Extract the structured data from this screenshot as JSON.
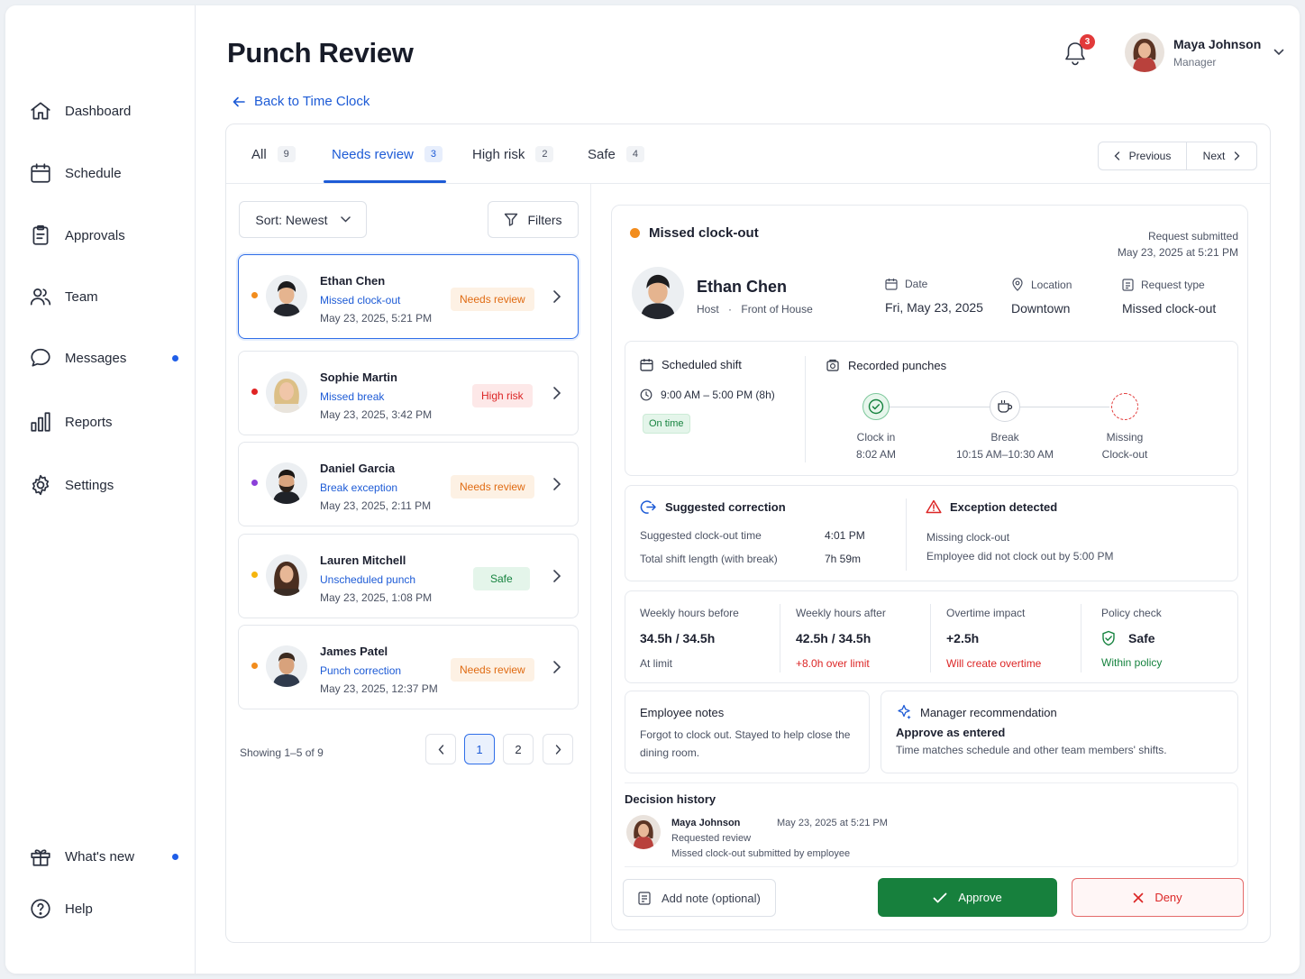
{
  "sidebar": {
    "items": [
      {
        "label": "Dashboard",
        "icon": "home-icon"
      },
      {
        "label": "Schedule",
        "icon": "calendar-icon"
      },
      {
        "label": "Approvals",
        "icon": "clipboard-icon"
      },
      {
        "label": "Team",
        "icon": "users-icon"
      },
      {
        "label": "Messages",
        "icon": "chat-icon",
        "has_dot": true
      },
      {
        "label": "Reports",
        "icon": "bar-chart-icon"
      },
      {
        "label": "Settings",
        "icon": "gear-icon"
      }
    ],
    "bottom": [
      {
        "label": "What's new",
        "icon": "gift-icon",
        "has_dot": true
      },
      {
        "label": "Help",
        "icon": "help-icon"
      }
    ]
  },
  "header": {
    "title": "Punch Review",
    "back_label": "Back to Time Clock",
    "notifications_count": "3",
    "user": {
      "name": "Maya Johnson",
      "role": "Manager"
    }
  },
  "tabs": [
    {
      "label": "All",
      "count": "9"
    },
    {
      "label": "Needs review",
      "count": "3",
      "active": true
    },
    {
      "label": "High risk",
      "count": "2"
    },
    {
      "label": "Safe",
      "count": "4"
    }
  ],
  "pager": {
    "previous": "Previous",
    "next": "Next"
  },
  "list": {
    "sort_label": "Sort: Newest",
    "filters_label": "Filters",
    "rows": [
      {
        "name": "Ethan Chen",
        "event": "Missed clock-out",
        "datetime": "May 23, 2025, 5:21 PM",
        "badge": "Needs review",
        "dot_color": "#f28c1c",
        "selected": true
      },
      {
        "name": "Sophie Martin",
        "event": "Missed break",
        "datetime": "May 23, 2025, 3:42 PM",
        "badge": "High risk",
        "dot_color": "#e02424"
      },
      {
        "name": "Daniel Garcia",
        "event": "Break exception",
        "datetime": "May 23, 2025, 2:11 PM",
        "badge": "Needs review",
        "dot_color": "#8b3fd9"
      },
      {
        "name": "Lauren Mitchell",
        "event": "Unscheduled punch",
        "datetime": "May 23, 2025, 1:08 PM",
        "badge": "Safe",
        "dot_color": "#f5b50e"
      },
      {
        "name": "James Patel",
        "event": "Punch correction",
        "datetime": "May 23, 2025, 12:37 PM",
        "badge": "Needs review",
        "dot_color": "#f28c1c"
      }
    ],
    "showing": "Showing 1–5 of 9",
    "pages": [
      "1",
      "2"
    ],
    "current_page": "1"
  },
  "detail": {
    "status": "Missed clock-out",
    "status_color": "#f28c1c",
    "submitted_label": "Request submitted",
    "submitted_at": "May 23, 2025 at 5:21 PM",
    "employee": {
      "name": "Ethan Chen",
      "role": "Host",
      "department": "Front of House"
    },
    "meta": {
      "date_label": "Date",
      "date_value": "Fri, May 23, 2025",
      "location_label": "Location",
      "location_value": "Downtown",
      "type_label": "Request type",
      "type_value": "Missed clock-out"
    },
    "scheduled": {
      "title": "Scheduled shift",
      "time": "9:00 AM – 5:00 PM (8h)",
      "status": "On time"
    },
    "recorded": {
      "title": "Recorded punches",
      "punches": [
        {
          "label": "Clock in",
          "time": "8:02 AM"
        },
        {
          "label": "Break",
          "time": "10:15 AM–10:30 AM"
        },
        {
          "label": "Missing",
          "time": "Clock-out"
        }
      ]
    },
    "suggestion": {
      "title": "Suggested correction",
      "rows": [
        {
          "label": "Suggested clock-out time",
          "value": "4:01 PM"
        },
        {
          "label": "Total shift length (with break)",
          "value": "7h 59m"
        }
      ]
    },
    "exception": {
      "title": "Exception detected",
      "line1": "Missing clock-out",
      "line2": "Employee did not clock out by 5:00 PM"
    },
    "metrics": [
      {
        "label": "Weekly hours before",
        "value": "34.5h / 34.5h",
        "sub": "At limit",
        "sub_color": "#4b5263"
      },
      {
        "label": "Weekly hours after",
        "value": "42.5h / 34.5h",
        "sub": "+8.0h over limit",
        "sub_color": "#dc2626"
      },
      {
        "label": "Overtime impact",
        "value": "+2.5h",
        "sub": "Will create overtime",
        "sub_color": "#dc2626"
      },
      {
        "label": "Policy check",
        "value": "Safe",
        "sub": "Within policy",
        "sub_color": "#16833f"
      }
    ],
    "notes": {
      "title": "Employee notes",
      "text": "Forgot to clock out. Stayed to help close the dining room."
    },
    "recommendation": {
      "title": "Manager recommendation",
      "headline": "Approve as entered",
      "text": "Time matches schedule and other team members' shifts."
    },
    "history": {
      "title": "Decision history",
      "name": "Maya Johnson",
      "time": "May 23, 2025 at 5:21 PM",
      "action": "Requested review",
      "detail": "Missed clock-out submitted by employee"
    },
    "actions": {
      "note_placeholder": "Add note (optional)",
      "approve": "Approve",
      "deny": "Deny"
    }
  }
}
